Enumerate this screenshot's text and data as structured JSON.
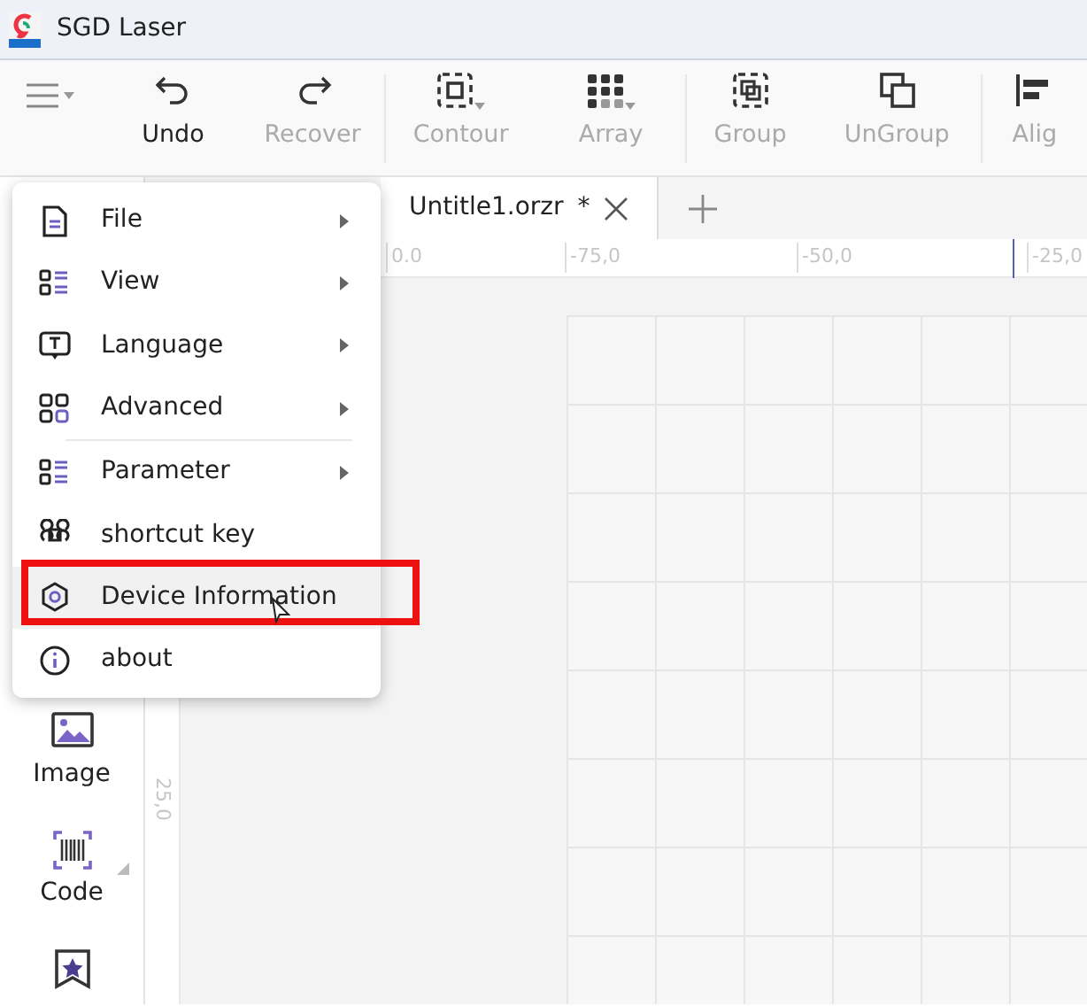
{
  "window": {
    "title": "SGD Laser"
  },
  "toolbar": {
    "items": [
      {
        "label": "Undo",
        "disabled": false,
        "has_menu": false,
        "separator_before": false
      },
      {
        "label": "Recover",
        "disabled": true,
        "has_menu": false,
        "separator_before": false
      },
      {
        "label": "Contour",
        "disabled": true,
        "has_menu": true,
        "separator_before": true
      },
      {
        "label": "Array",
        "disabled": true,
        "has_menu": true,
        "separator_before": false
      },
      {
        "label": "Group",
        "disabled": true,
        "has_menu": false,
        "separator_before": true
      },
      {
        "label": "UnGroup",
        "disabled": true,
        "has_menu": false,
        "separator_before": false
      },
      {
        "label": "Alig",
        "disabled": true,
        "has_menu": false,
        "separator_before": true
      }
    ]
  },
  "tabs": [
    {
      "label": "Untitle1.orzr",
      "modified_mark": "*",
      "selected": true
    }
  ],
  "ruler": {
    "top_labels": [
      "0.0",
      "-75,0",
      "-50,0",
      "-25,0"
    ],
    "left_labels": [
      "25,0"
    ]
  },
  "tools": [
    {
      "label": "Image",
      "has_menu": false
    },
    {
      "label": "Code",
      "has_menu": true
    },
    {
      "has_menu": false
    }
  ],
  "menu": {
    "items": [
      {
        "label": "File",
        "has_submenu": true,
        "separator_before": false,
        "highlighted": false
      },
      {
        "label": "View",
        "has_submenu": true,
        "separator_before": false,
        "highlighted": false
      },
      {
        "label": "Language",
        "has_submenu": true,
        "separator_before": false,
        "highlighted": false
      },
      {
        "label": "Advanced",
        "has_submenu": true,
        "separator_before": false,
        "highlighted": false
      },
      {
        "label": "Parameter",
        "has_submenu": true,
        "separator_before": true,
        "highlighted": false
      },
      {
        "label": "shortcut key",
        "has_submenu": false,
        "separator_before": false,
        "highlighted": false
      },
      {
        "label": "Device Information",
        "has_submenu": false,
        "separator_before": false,
        "highlighted": true
      },
      {
        "label": "about",
        "has_submenu": false,
        "separator_before": false,
        "highlighted": false
      }
    ]
  }
}
